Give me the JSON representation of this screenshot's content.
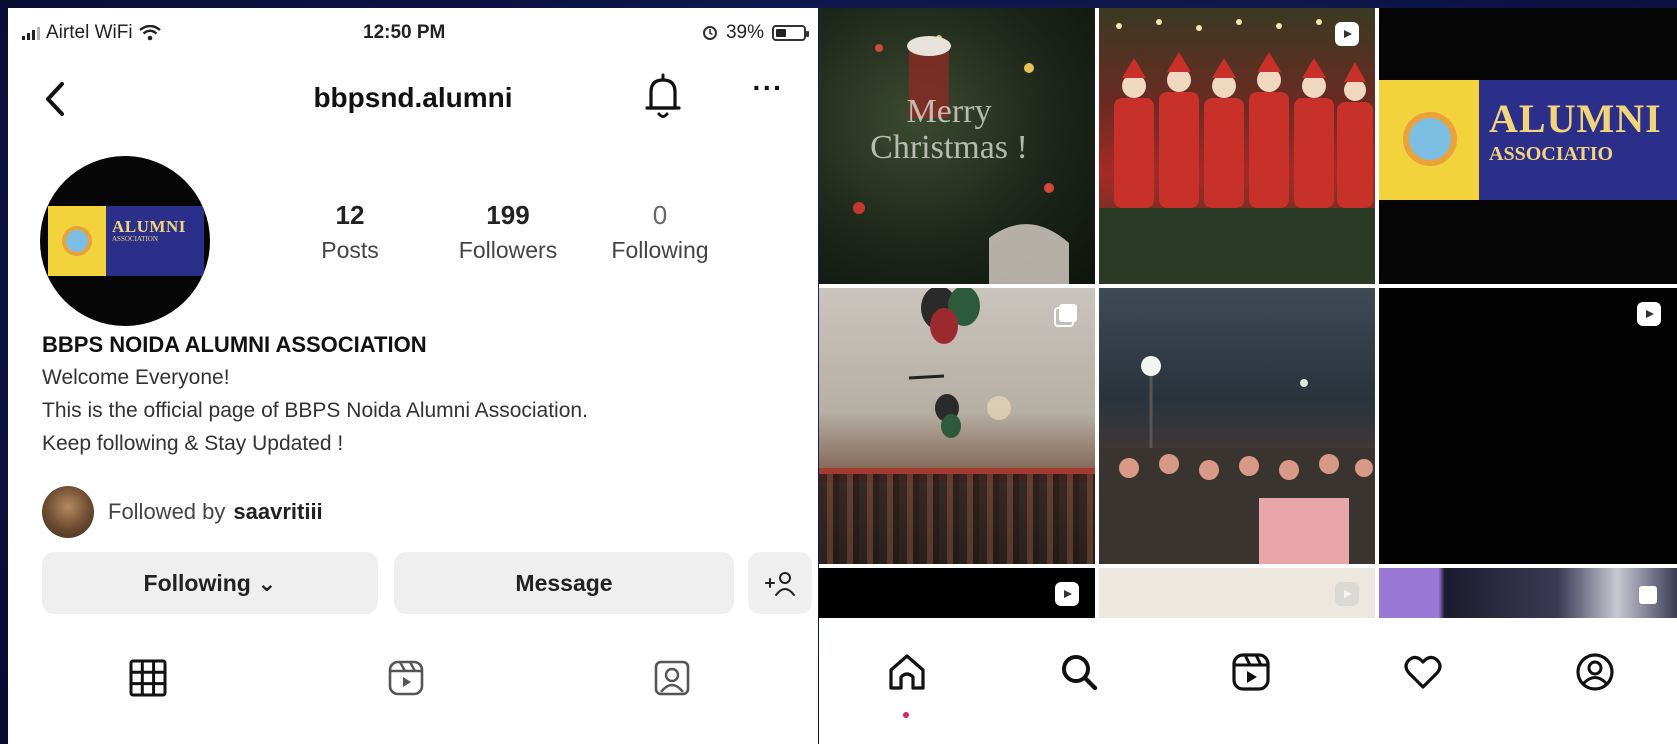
{
  "status_bar": {
    "carrier": "Airtel WiFi",
    "time": "12:50 PM",
    "battery": "39%",
    "battery_level": 0.39
  },
  "header": {
    "username": "bbpsnd.alumni",
    "more_label": "···"
  },
  "avatar_logo": {
    "line1": "ALUMNI",
    "line2": "ASSOCIATION"
  },
  "stats": {
    "posts": {
      "value": "12",
      "label": "Posts"
    },
    "followers": {
      "value": "199",
      "label": "Followers"
    },
    "following": {
      "value": "0",
      "label": "Following"
    }
  },
  "bio": {
    "name": "BBPS NOIDA ALUMNI ASSOCIATION",
    "line1": "Welcome Everyone!",
    "line2": "This is the official page of BBPS Noida Alumni Association.",
    "line3": "Keep following & Stay Updated !"
  },
  "followed_by": {
    "prefix": "Followed by",
    "user": "saavritiii"
  },
  "actions": {
    "following": "Following ⌄",
    "message": "Message",
    "suggest": "+ጸ"
  },
  "profile_tabs": [
    {
      "name": "grid-icon"
    },
    {
      "name": "reels-icon"
    },
    {
      "name": "tagged-icon"
    }
  ],
  "posts": {
    "christmas_text": "Merry Christmas !",
    "logo_line1": "ALUMNI",
    "logo_line2": "ASSOCIATIO"
  },
  "bottom_nav": [
    {
      "name": "home-icon"
    },
    {
      "name": "search-icon"
    },
    {
      "name": "reels-icon"
    },
    {
      "name": "heart-icon"
    },
    {
      "name": "profile-icon"
    }
  ],
  "colors": {
    "background": "#0d1446",
    "logo_blue": "#2c2f8a",
    "logo_yellow": "#f2d33c",
    "button_gray": "#efefef",
    "notification_dot": "#e0245e"
  }
}
